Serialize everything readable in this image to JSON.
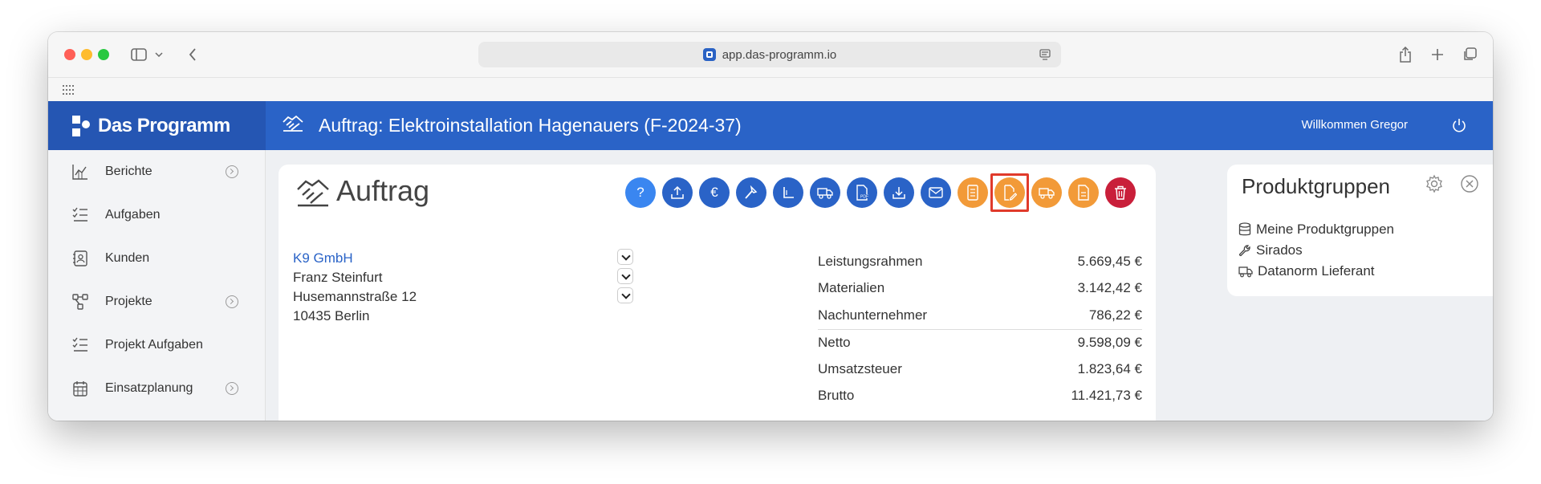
{
  "browser": {
    "url": "app.das-programm.io"
  },
  "app": {
    "logo_text": "Das Programm",
    "header_title": "Auftrag: Elektroinstallation Hagenauers (F-2024-37)",
    "welcome_text": "Willkommen Gregor",
    "colors": {
      "primary": "#2a63c7",
      "sidebar_head": "#2556b3",
      "orange": "#f29a38",
      "danger": "#c91f3a",
      "highlight": "#e03a2b"
    }
  },
  "sidebar": {
    "items": [
      {
        "label": "Berichte",
        "icon": "chart-icon",
        "has_chevron": true
      },
      {
        "label": "Aufgaben",
        "icon": "checklist-icon",
        "has_chevron": false
      },
      {
        "label": "Kunden",
        "icon": "contact-card-icon",
        "has_chevron": false
      },
      {
        "label": "Projekte",
        "icon": "project-tree-icon",
        "has_chevron": true
      },
      {
        "label": "Projekt Aufgaben",
        "icon": "checklist-icon",
        "has_chevron": false
      },
      {
        "label": "Einsatzplanung",
        "icon": "calendar-icon",
        "has_chevron": true
      }
    ]
  },
  "order": {
    "title": "Auftrag",
    "actions": [
      {
        "icon": "help-icon",
        "glyph": "?"
      },
      {
        "icon": "upload-icon"
      },
      {
        "icon": "euro-icon",
        "glyph": "€"
      },
      {
        "icon": "hammer-icon"
      },
      {
        "icon": "angle-icon"
      },
      {
        "icon": "truck-icon"
      },
      {
        "icon": "pdf-icon"
      },
      {
        "icon": "download-icon"
      },
      {
        "icon": "mail-icon"
      },
      {
        "icon": "document-icon"
      },
      {
        "icon": "edit-document-icon",
        "highlighted": true
      },
      {
        "icon": "delivery-truck-icon"
      },
      {
        "icon": "file-icon"
      },
      {
        "icon": "trash-icon"
      }
    ],
    "customer": {
      "company": "K9 GmbH",
      "contact": "Franz Steinfurt",
      "street": "Husemannstraße 12",
      "city": "10435 Berlin"
    },
    "totals": [
      {
        "label": "Leistungsrahmen",
        "value": "5.669,45 €"
      },
      {
        "label": "Materialien",
        "value": "3.142,42 €"
      },
      {
        "label": "Nachunternehmer",
        "value": "786,22 €"
      },
      {
        "label": "Netto",
        "value": "9.598,09 €"
      },
      {
        "label": "Umsatzsteuer",
        "value": "1.823,64 €"
      },
      {
        "label": "Brutto",
        "value": "11.421,73 €"
      }
    ]
  },
  "product_groups": {
    "title": "Produktgruppen",
    "items": [
      {
        "label": "Meine Produktgruppen",
        "icon": "database-icon"
      },
      {
        "label": "Sirados",
        "icon": "wrench-icon"
      },
      {
        "label": "Datanorm Lieferant",
        "icon": "truck-icon"
      }
    ]
  }
}
